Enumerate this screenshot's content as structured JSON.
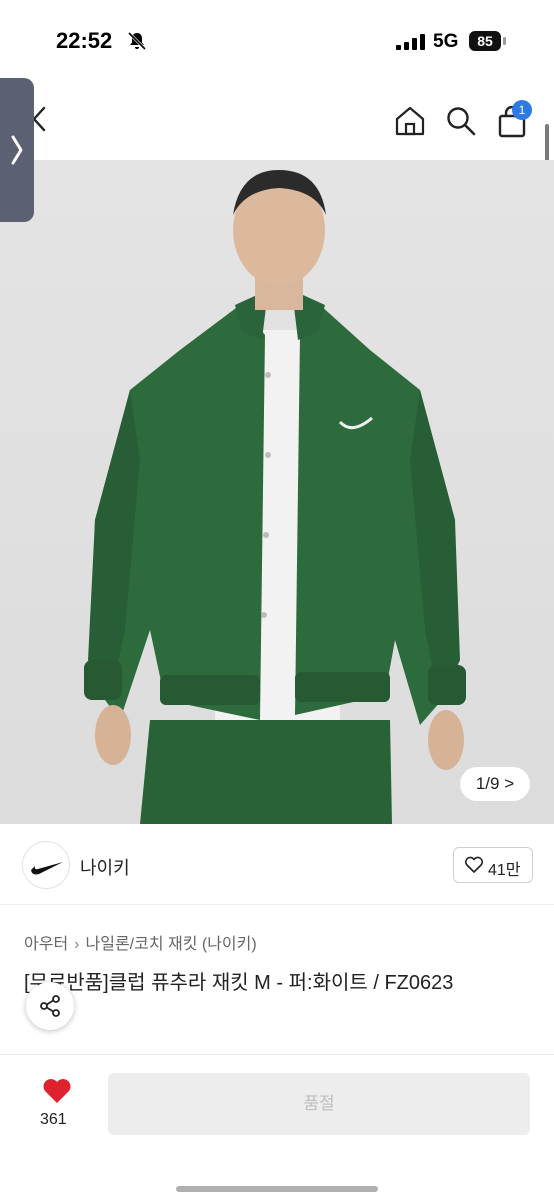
{
  "status": {
    "time": "22:52",
    "network": "5G",
    "battery": "85"
  },
  "nav": {
    "cart_count": "1"
  },
  "gallery": {
    "counter": "1/9 >"
  },
  "seller": {
    "name": "나이키",
    "likes": "41만"
  },
  "breadcrumb": {
    "items": [
      "아우터",
      "나일론/코치 재킷 (나이키)"
    ]
  },
  "product": {
    "title": "[무료반품]클럽 퓨추라 재킷 M - 퍼:화이트 / FZ0623"
  },
  "bottom": {
    "wish_count": "361",
    "action_label": "품절"
  },
  "colors": {
    "accent": "#2c7be5",
    "heart_red": "#e0222d",
    "jacket_green": "#2e6b3c"
  }
}
